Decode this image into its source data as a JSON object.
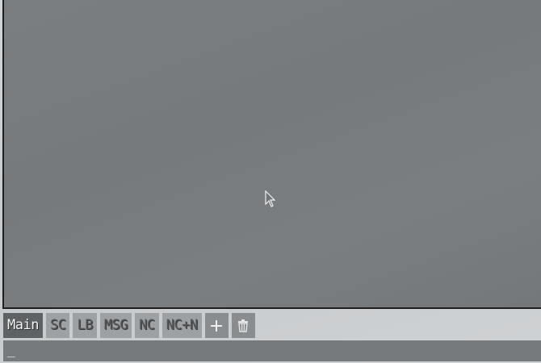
{
  "tabs": [
    {
      "label": "Main",
      "active": true
    },
    {
      "label": "SC",
      "active": false
    },
    {
      "label": "LB",
      "active": false
    },
    {
      "label": "MSG",
      "active": false
    },
    {
      "label": "NC",
      "active": false
    },
    {
      "label": "NC+N",
      "active": false
    }
  ],
  "tab_actions": {
    "add_icon": "plus-icon",
    "delete_icon": "trash-icon"
  },
  "input": {
    "caret": "_"
  },
  "colors": {
    "panel": "#787b7d",
    "active_tab": "#5f6264",
    "inactive_tab": "#9ea1a3"
  }
}
